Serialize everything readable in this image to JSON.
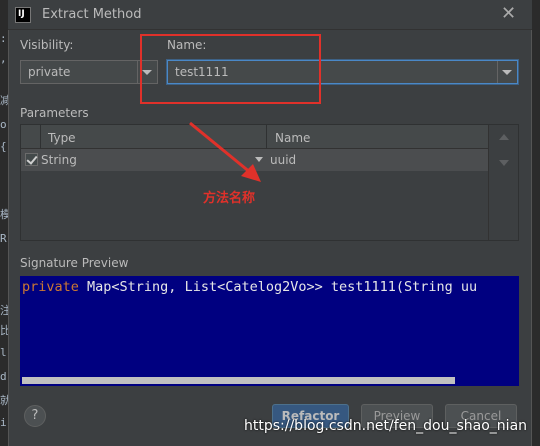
{
  "editor": {
    "gutter_chars": [
      ":",
      ",",
      "减",
      "o",
      "{",
      "模",
      "R",
      "注",
      "比",
      "l",
      "d",
      "就",
      "i"
    ]
  },
  "window": {
    "title": "Extract Method",
    "close_glyph": "✕",
    "icon_letters": "IJ"
  },
  "visibility": {
    "label": "Visibility:",
    "value": "private"
  },
  "name": {
    "label": "Name:",
    "value": "test1111"
  },
  "parameters": {
    "label": "Parameters",
    "columns": [
      "Type",
      "Name"
    ],
    "rows": [
      {
        "checked": true,
        "type": "String",
        "name": "uuid"
      }
    ]
  },
  "annotation": {
    "text": "方法名称",
    "color": "#e0312a"
  },
  "signature": {
    "label": "Signature Preview",
    "keyword": "private",
    "rest": " Map<String, List<Catelog2Vo>> test1111(String uu"
  },
  "buttons": {
    "help": "?",
    "refactor": "Refactor",
    "preview": "Preview",
    "cancel": "Cancel"
  },
  "watermark": "https://blog.csdn.net/fen_dou_shao_nian",
  "colors": {
    "dialog_bg": "#3c3f41",
    "signature_bg": "#000080",
    "primary_button": "#365880",
    "highlight_box": "#e0312a"
  }
}
